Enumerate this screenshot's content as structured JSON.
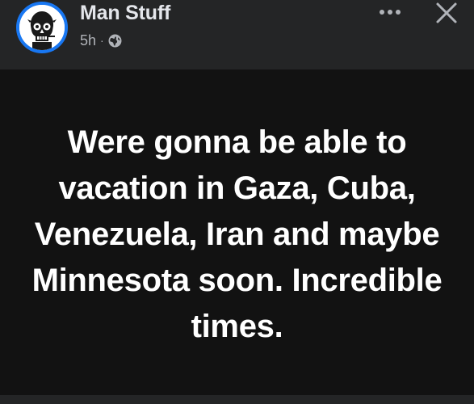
{
  "post": {
    "author": "Man Stuff",
    "timestamp": "5h",
    "separator": "·",
    "audience_icon": "globe-icon",
    "text": "Were gonna be able to vacation in Gaza, Cuba, Venezuela, Iran and maybe Minnesota soon. Incredible times."
  },
  "header": {
    "more_icon": "more-horizontal-icon",
    "close_icon": "close-icon"
  },
  "colors": {
    "header_background": "#242526",
    "post_background": "#121212",
    "avatar_ring": "#1877f2",
    "primary_text": "#e4e6eb",
    "secondary_text": "#b0b3b8",
    "post_text": "#ffffff"
  }
}
